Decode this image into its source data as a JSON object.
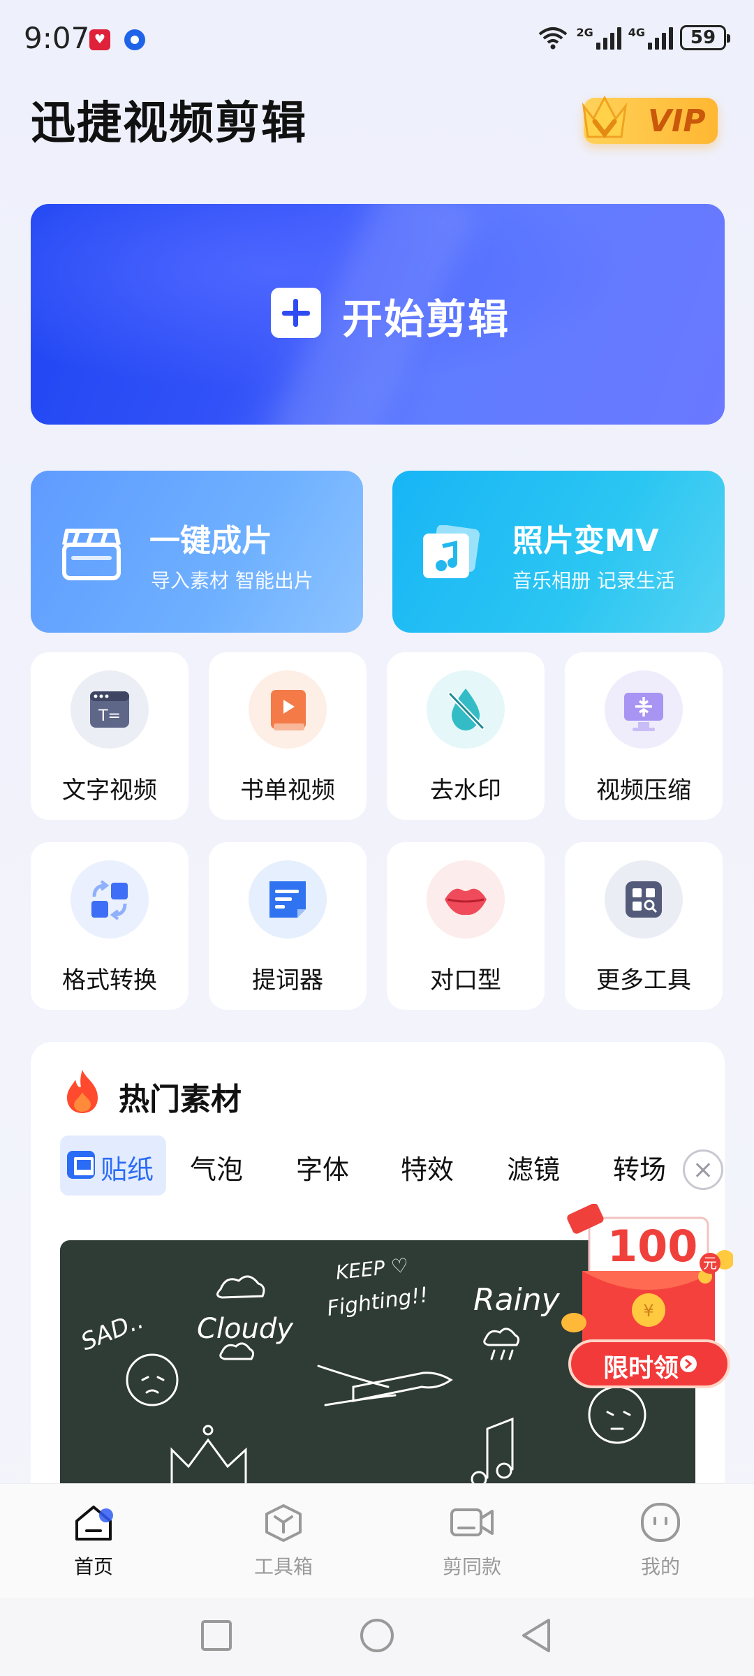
{
  "status_bar": {
    "time": "9:07",
    "net_2g": "2G",
    "net_4g": "4G",
    "battery": "59"
  },
  "header": {
    "title": "迅捷视频剪辑",
    "vip": "VIP"
  },
  "banner": {
    "label": "开始剪辑"
  },
  "features": [
    {
      "title": "一键成片",
      "subtitle": "导入素材 智能出片"
    },
    {
      "title": "照片变MV",
      "subtitle": "音乐相册 记录生活"
    }
  ],
  "tools": [
    {
      "label": "文字视频",
      "icon": "text-video-icon"
    },
    {
      "label": "书单视频",
      "icon": "booklist-video-icon"
    },
    {
      "label": "去水印",
      "icon": "remove-watermark-icon"
    },
    {
      "label": "视频压缩",
      "icon": "video-compress-icon"
    },
    {
      "label": "格式转换",
      "icon": "format-convert-icon"
    },
    {
      "label": "提词器",
      "icon": "teleprompter-icon"
    },
    {
      "label": "对口型",
      "icon": "lip-sync-icon"
    },
    {
      "label": "更多工具",
      "icon": "more-tools-icon"
    }
  ],
  "hot": {
    "title": "热门素材",
    "tabs": [
      "贴纸",
      "气泡",
      "字体",
      "特效",
      "滤镜",
      "转场"
    ],
    "sticker_words": [
      "SAD..",
      "Cloudy",
      "KEEP ♡",
      "Fighting!!",
      "Rainy"
    ]
  },
  "promo": {
    "amount": "100",
    "unit": "元",
    "cta": "限时领"
  },
  "nav": [
    "首页",
    "工具箱",
    "剪同款",
    "我的"
  ],
  "colors": {
    "primary": "#2f4cf2",
    "vip_gold": "#ffc23d",
    "promo_red": "#f23a3a"
  }
}
